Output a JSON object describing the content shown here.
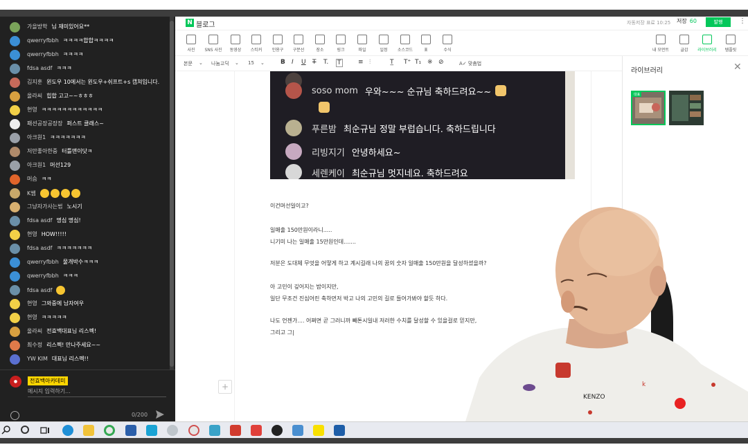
{
  "chat": {
    "messages": [
      {
        "author": "가을방학",
        "text": "님 재미있어요**",
        "avatar_color": "#7aa35a"
      },
      {
        "author": "qwerryfbbh",
        "text": "ㅋㅋㅋㅋ합합ㅋㅋㅋㅋ",
        "avatar_color": "#3b8fd6"
      },
      {
        "author": "qwerryfbbh",
        "text": "ㅋㅋㅋㅋ",
        "avatar_color": "#3b8fd6"
      },
      {
        "author": "fdsa asdf",
        "text": "ㅋㅋㅋ",
        "avatar_color": "#6a8fa8"
      },
      {
        "author": "김지훈",
        "text": "윈도우 10에서는 윈도우+쉬프트+s 캡쳐입니다.",
        "avatar_color": "#c86a5a"
      },
      {
        "author": "올라씨",
        "text": "힙합 고고~~ㅎㅎㅎ",
        "avatar_color": "#d8a040"
      },
      {
        "author": "현영",
        "text": "ㅋㅋㅋㅋㅋㅋㅋㅋㅋㅋㅋㅋ",
        "avatar_color": "#f2d047"
      },
      {
        "author": "패션공장공장장",
        "text": "퍼스트 클래스~",
        "avatar_color": "#eeeeee"
      },
      {
        "author": "아크원1",
        "text": "ㅋㅋㅋㅋㅋㅋㅋ",
        "avatar_color": "#9aa0a8"
      },
      {
        "author": "저만좋아한중",
        "text": "터틀맨이닷ㅋ",
        "avatar_color": "#b08a6a"
      },
      {
        "author": "아크원1",
        "text": "머선129",
        "avatar_color": "#9aa0a8"
      },
      {
        "author": "머슴",
        "text": "ㅋㅋ",
        "avatar_color": "#e0642a"
      },
      {
        "author": "K쌤",
        "text": "",
        "avatar_color": "#c8a86a",
        "emojis": 4
      },
      {
        "author": "그냥자가사는법",
        "text": "노시기",
        "avatar_color": "#d8b070"
      },
      {
        "author": "fdsa asdf",
        "text": "명심 명심!",
        "avatar_color": "#6a8fa8"
      },
      {
        "author": "현영",
        "text": "HOW!!!!!",
        "avatar_color": "#f2d047"
      },
      {
        "author": "fdsa asdf",
        "text": "ㅋㅋㅋㅋㅋㅋㅋ",
        "avatar_color": "#6a8fa8"
      },
      {
        "author": "qwerryfbbh",
        "text": "물개박수ㅋㅋㅋ",
        "avatar_color": "#3b8fd6"
      },
      {
        "author": "qwerryfbbh",
        "text": "ㅋㅋㅋ",
        "avatar_color": "#3b8fd6"
      },
      {
        "author": "fdsa asdf",
        "text": "",
        "avatar_color": "#6a8fa8",
        "emojis": 1
      },
      {
        "author": "현영",
        "text": "그와중에 남자여우",
        "avatar_color": "#f2d047"
      },
      {
        "author": "현영",
        "text": "ㅋㅋㅋㅋㅋ",
        "avatar_color": "#f2d047"
      },
      {
        "author": "올라씨",
        "text": "전효백대표님 리스펙!",
        "avatar_color": "#d8a040"
      },
      {
        "author": "최수정",
        "text": "리스펙! 만나주세요~~",
        "avatar_color": "#e07a4a"
      },
      {
        "author": "YW KIM",
        "text": "대표님 리스펙!!",
        "avatar_color": "#5a6fd0"
      }
    ],
    "self_name": "전효백아카데미",
    "input_placeholder": "메시지 입력하기...",
    "char_count": "0/200"
  },
  "editor": {
    "logo_letter": "N",
    "logo_text": "블로그",
    "autosave": "자동저장 표료 10:25",
    "save_label": "저장",
    "save_count": "60",
    "publish_label": "발행",
    "toolbar": [
      {
        "label": "사진"
      },
      {
        "label": "SNS 사진"
      },
      {
        "label": "동영상"
      },
      {
        "label": "스티커"
      },
      {
        "label": "인용구"
      },
      {
        "label": "구분선"
      },
      {
        "label": "장소"
      },
      {
        "label": "링크"
      },
      {
        "label": "파일"
      },
      {
        "label": "일정"
      },
      {
        "label": "소스코드"
      },
      {
        "label": "표"
      },
      {
        "label": "수식"
      }
    ],
    "toolbar_right": [
      {
        "label": "내 모먼트"
      },
      {
        "label": "글감"
      },
      {
        "label": "라이브러리"
      },
      {
        "label": "템플릿"
      }
    ],
    "format": {
      "style": "본문",
      "font": "나눔고딕",
      "size": "15",
      "spellcheck": "맞춤법"
    },
    "embed": {
      "rows": [
        {
          "name": "soso mom",
          "msg": "우와~~~ 순규님 축하드려요~~"
        },
        {
          "name": "푸른밤",
          "msg": "최순규님 정말 부럽습니다. 축하드립니다"
        },
        {
          "name": "리빙지기",
          "msg": "안녕하세요~"
        },
        {
          "name": "세렌케이",
          "msg": "최순규님 멋지네요. 축하드려요"
        }
      ]
    },
    "paragraphs": [
      "이건머선일이고?",
      "일매출 150만원이라니.....",
      "니기미 나는 일매출 15만원인데.......",
      "저분은 도대체 무엇을 어떻게 하고 계시길래 나의 꿈의 숫자 일매출 150만원을 달성하셨을까?",
      "아 고민이 깊어지는 밤이지만,",
      "일단 무조건 진심어린 축하먼저 박고 나의 고민의 길로 들어가봐야 할듯 하다.",
      "나도 언젠가.... 어쩌면 곧 그러니까 빼톤시일내 저러한 수치를 달성할 수 있을걸로 믿지만,",
      "그리고 그|"
    ]
  },
  "library": {
    "title": "라이브러리",
    "badge": "대표"
  },
  "colors": {
    "naver_green": "#03c75a",
    "chat_bg": "#212121",
    "self_name_bg": "#ffd600"
  }
}
